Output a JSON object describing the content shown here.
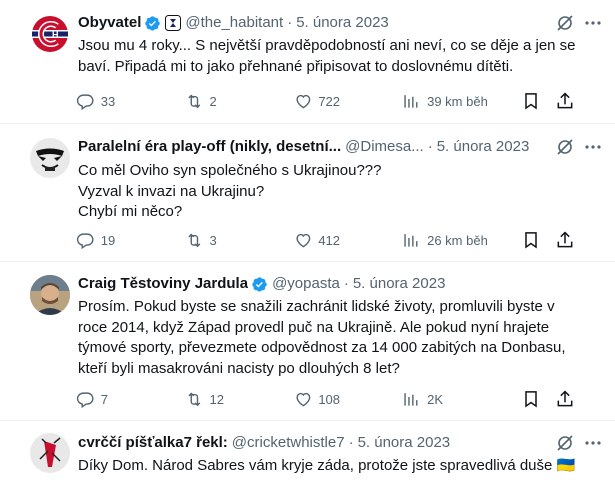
{
  "tweets": [
    {
      "name": "Obyvatel",
      "handle": "@the_habitant",
      "date": "5. února 2023",
      "text": [
        "Jsou mu 4 roky... S největší pravděpodobností ani neví, co se děje a jen se baví. Připadá mi to jako přehnané připisovat to doslovnému dítěti."
      ],
      "replies": "33",
      "retweets": "2",
      "likes": "722",
      "views": "39 km běh",
      "verified": true,
      "avatar": "habs-logo"
    },
    {
      "name": "Paralelní éra play-off (nikly, desetinná...",
      "name_display": "Paralelní éra play-off (nikly, desetní...",
      "handle": "@Dimesa...",
      "date": "5. února 2023",
      "text": [
        "Co měl Oviho syn společného s Ukrajinou???",
        "Vyzval k invazi na Ukrajinu?",
        "Chybí mi něco?"
      ],
      "replies": "19",
      "retweets": "3",
      "likes": "412",
      "views": "26 km běh",
      "verified": false,
      "avatar": "masked-face"
    },
    {
      "name": "Craig Těstoviny Jardula",
      "handle": "@yopasta",
      "date": "5. února 2023",
      "text": [
        "Prosím. Pokud byste se snažili zachránit lidské životy, promluvili byste v roce 2014, když Západ provedl puč na Ukrajině. Ale pokud nyní hrajete týmové sporty, převezmete odpovědnost za 14 000 zabitých na Donbasu, kteří byli masakrováni nacisty po dlouhých 8 let?"
      ],
      "replies": "7",
      "retweets": "12",
      "likes": "108",
      "views": "2K",
      "verified": true,
      "avatar": "man-photo"
    },
    {
      "name": "cvrččí píšťalka7 řekl:",
      "handle": "@cricketwhistle7",
      "date": "5. února 2023",
      "text": [
        "Díky Dom. Národ Sabres vám kryje záda, protože jste spravedlivá duše 🇺🇦"
      ],
      "verified": false,
      "avatar": "cricket-logo"
    }
  ],
  "colors": {
    "accent": "#1d9bf0",
    "muted": "#536471",
    "text": "#0f1419",
    "divider": "#eff3f4"
  },
  "icons": [
    "verified-badge-icon",
    "affiliate-badge-icon",
    "grok-icon",
    "reply-icon",
    "retweet-icon",
    "like-icon",
    "views-icon",
    "bookmark-icon",
    "share-icon"
  ]
}
